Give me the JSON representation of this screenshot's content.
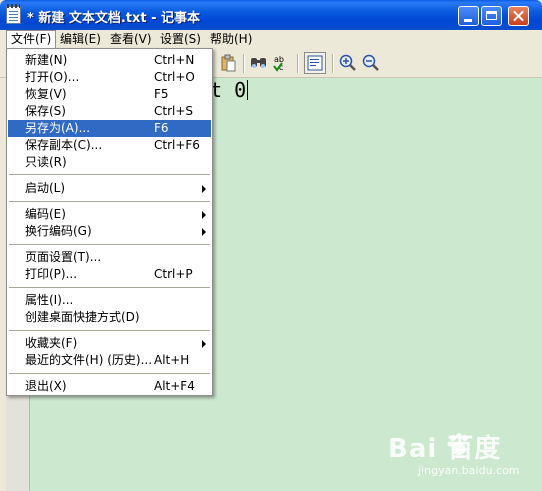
{
  "window": {
    "title": "* 新建 文本文档.txt - 记事本"
  },
  "menubar": {
    "items": [
      {
        "label": "文件(F)"
      },
      {
        "label": "编辑(E)"
      },
      {
        "label": "查看(V)"
      },
      {
        "label": "设置(S)"
      },
      {
        "label": "帮助(H)"
      }
    ]
  },
  "toolbar": {
    "icons": [
      "paste-icon",
      "find-icon",
      "spell-check-icon",
      "word-wrap-icon",
      "zoom-in-icon",
      "zoom-out-icon"
    ]
  },
  "editor": {
    "visible_text": "t 0"
  },
  "file_menu": {
    "items": [
      {
        "label": "新建(N)",
        "shortcut": "Ctrl+N"
      },
      {
        "label": "打开(O)...",
        "shortcut": "Ctrl+O"
      },
      {
        "label": "恢复(V)",
        "shortcut": "F5"
      },
      {
        "label": "保存(S)",
        "shortcut": "Ctrl+S"
      },
      {
        "label": "另存为(A)...",
        "shortcut": "F6",
        "highlighted": true
      },
      {
        "label": "保存副本(C)...",
        "shortcut": "Ctrl+F6"
      },
      {
        "label": "只读(R)",
        "shortcut": ""
      },
      {
        "label": "启动(L)",
        "shortcut": "",
        "submenu": true
      },
      {
        "label": "编码(E)",
        "shortcut": "",
        "submenu": true
      },
      {
        "label": "换行编码(G)",
        "shortcut": "",
        "submenu": true
      },
      {
        "label": "页面设置(T)...",
        "shortcut": ""
      },
      {
        "label": "打印(P)...",
        "shortcut": "Ctrl+P"
      },
      {
        "label": "属性(I)...",
        "shortcut": ""
      },
      {
        "label": "创建桌面快捷方式(D)",
        "shortcut": ""
      },
      {
        "label": "收藏夹(F)",
        "shortcut": "",
        "submenu": true
      },
      {
        "label": "最近的文件(H) (历史)...",
        "shortcut": "Alt+H"
      },
      {
        "label": "退出(X)",
        "shortcut": "Alt+F4"
      }
    ]
  },
  "watermark": {
    "logo": "Bai  百度",
    "sub": "jingyan.baidu.com"
  },
  "colors": {
    "highlight": "#316ac5",
    "editor_bg": "#cce8cf",
    "titlebar": "#0a5adf"
  }
}
